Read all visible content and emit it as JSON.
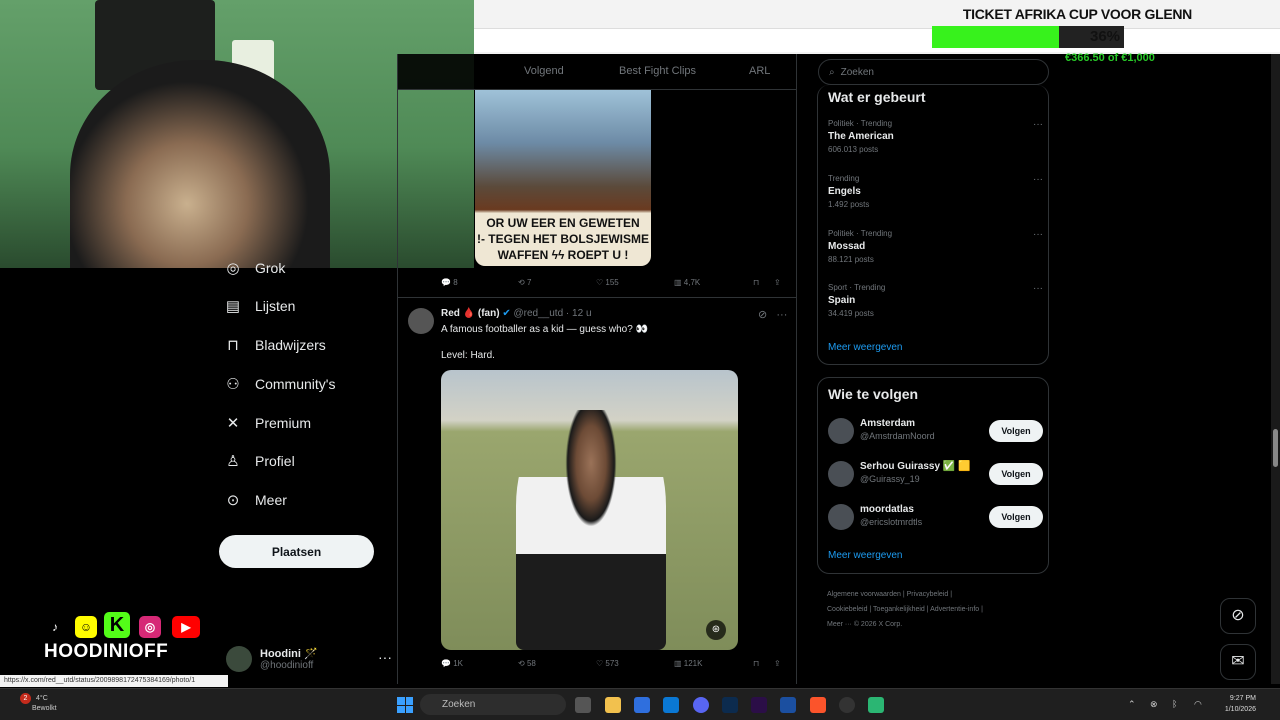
{
  "overlay": {
    "donation_title": "TICKET AFRIKA CUP VOOR GLENN",
    "donation_percent": "36%",
    "donation_progress": 0.66,
    "donation_amount": "€366.50 of €1,000",
    "brand_name": "HOODINIOFF"
  },
  "tabs": [
    {
      "label": "Volgend"
    },
    {
      "label": "Best Fight Clips"
    },
    {
      "label": "ARL"
    }
  ],
  "nav": {
    "items": [
      {
        "label": "Grok",
        "icon": "grok-icon"
      },
      {
        "label": "Lijsten",
        "icon": "list-icon"
      },
      {
        "label": "Bladwijzers",
        "icon": "bookmark-icon"
      },
      {
        "label": "Community's",
        "icon": "communities-icon"
      },
      {
        "label": "Premium",
        "icon": "x-logo-icon"
      },
      {
        "label": "Profiel",
        "icon": "profile-icon"
      },
      {
        "label": "Meer",
        "icon": "more-circle-icon"
      }
    ],
    "post_button": "Plaatsen",
    "profile_name": "Hoodini 🪄",
    "profile_handle": "@hoodinioff",
    "profile_more": "···"
  },
  "tweet1": {
    "poster_line1": "OR UW EER EN GEWETEN",
    "poster_line2": "!- TEGEN HET BOLSJEWISME",
    "poster_line3": "WAFFEN ϟϟ ROEPT U !",
    "replies": "8",
    "reposts": "7",
    "likes": "155",
    "views": "4,7K"
  },
  "tweet2": {
    "name": "Red 🩸 (fan)",
    "handle": "@red__utd",
    "time": "12 u",
    "text": "A famous footballer as a kid — guess who? 👀",
    "text2": "Level: Hard.",
    "replies": "1K",
    "reposts": "58",
    "likes": "573",
    "views": "121K",
    "more": "···"
  },
  "search": {
    "placeholder": "Zoeken"
  },
  "trending": {
    "title": "Wat er gebeurt",
    "items": [
      {
        "category": "Politiek · Trending",
        "topic": "The American",
        "posts": "606.013 posts"
      },
      {
        "category": "Trending",
        "topic": "Engels",
        "posts": "1.492 posts"
      },
      {
        "category": "Politiek · Trending",
        "topic": "Mossad",
        "posts": "88.121 posts"
      },
      {
        "category": "Sport · Trending",
        "topic": "Spain",
        "posts": "34.419 posts"
      }
    ],
    "more_label": "···",
    "show_more": "Meer weergeven"
  },
  "follow": {
    "title": "Wie te volgen",
    "items": [
      {
        "name": "Amsterdam",
        "handle": "@AmstrdamNoord",
        "button": "Volgen"
      },
      {
        "name": "Serhou Guirassy ✅ 🟨",
        "handle": "@Guirassy_19",
        "button": "Volgen"
      },
      {
        "name": "moordatlas",
        "handle": "@ericslotmrdtls",
        "button": "Volgen"
      }
    ],
    "show_more": "Meer weergeven"
  },
  "footer": {
    "line1": "Algemene voorwaarden  |  Privacybeleid  |",
    "line2": "Cookiebeleid  |  Toegankelijkheid  |  Advertentie-info  |",
    "line3": "Meer ···   © 2026 X Corp."
  },
  "status_url": "https://x.com/red__utd/status/2009898172475384169/photo/1",
  "taskbar": {
    "weather_temp": "4°C",
    "weather_desc": "Bewolkt",
    "weather_badge": "2",
    "search_placeholder": "Zoeken",
    "time": "9:27 PM",
    "date": "1/10/2026"
  }
}
